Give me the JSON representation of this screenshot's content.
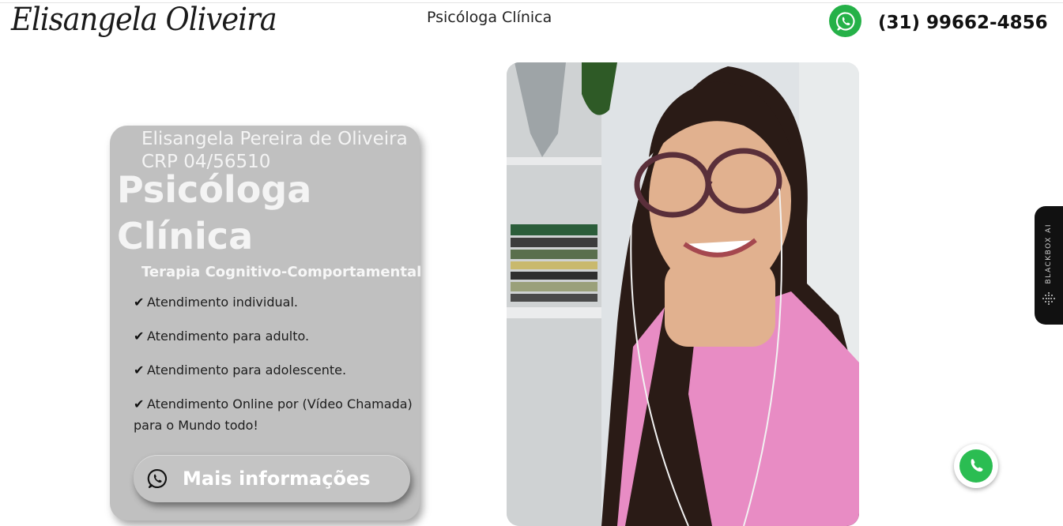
{
  "header": {
    "logo_text": "Elisangela Oliveira",
    "title": "Psicóloga Clínica",
    "phone": "(31) 99662-4856"
  },
  "hero": {
    "name": "Elisangela Pereira de Oliveira",
    "crp": "CRP 04/56510",
    "headline": "Psicóloga Clínica",
    "subtitle": "Terapia Cognitivo-Comportamental",
    "features": [
      "Atendimento individual.",
      "Atendimento para adulto.",
      "Atendimento para adolescente.",
      "Atendimento Online por (Vídeo Chamada) para o Mundo todo!"
    ],
    "cta_label": "Mais informações"
  },
  "side_tab": {
    "label": "BLACKBOX AI"
  },
  "icons": {
    "header_whatsapp": "whatsapp-icon",
    "cta": "whatsapp-icon",
    "check": "check-icon",
    "floating": "phone-icon"
  },
  "colors": {
    "card_bg": "#c0c0c0",
    "whatsapp_green": "#25b148",
    "side_tab_bg": "#111111"
  }
}
